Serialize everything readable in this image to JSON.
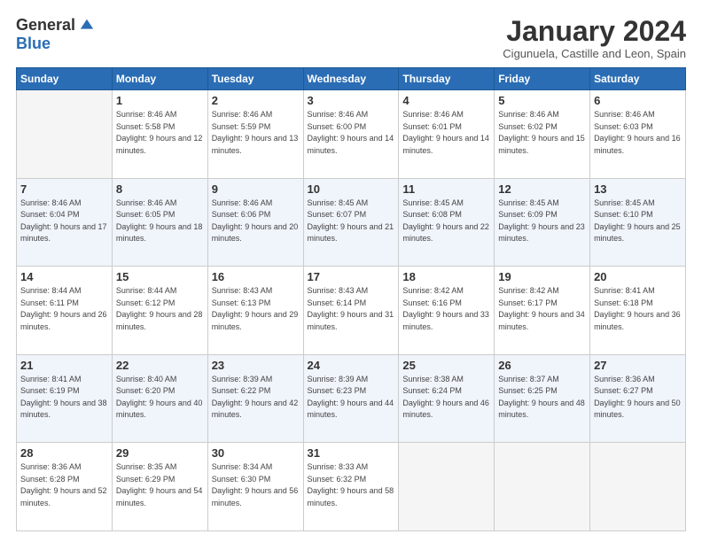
{
  "logo": {
    "general": "General",
    "blue": "Blue"
  },
  "header": {
    "month": "January 2024",
    "location": "Cigunuela, Castille and Leon, Spain"
  },
  "weekdays": [
    "Sunday",
    "Monday",
    "Tuesday",
    "Wednesday",
    "Thursday",
    "Friday",
    "Saturday"
  ],
  "weeks": [
    [
      {
        "day": "",
        "sunrise": "",
        "sunset": "",
        "daylight": ""
      },
      {
        "day": "1",
        "sunrise": "Sunrise: 8:46 AM",
        "sunset": "Sunset: 5:58 PM",
        "daylight": "Daylight: 9 hours and 12 minutes."
      },
      {
        "day": "2",
        "sunrise": "Sunrise: 8:46 AM",
        "sunset": "Sunset: 5:59 PM",
        "daylight": "Daylight: 9 hours and 13 minutes."
      },
      {
        "day": "3",
        "sunrise": "Sunrise: 8:46 AM",
        "sunset": "Sunset: 6:00 PM",
        "daylight": "Daylight: 9 hours and 14 minutes."
      },
      {
        "day": "4",
        "sunrise": "Sunrise: 8:46 AM",
        "sunset": "Sunset: 6:01 PM",
        "daylight": "Daylight: 9 hours and 14 minutes."
      },
      {
        "day": "5",
        "sunrise": "Sunrise: 8:46 AM",
        "sunset": "Sunset: 6:02 PM",
        "daylight": "Daylight: 9 hours and 15 minutes."
      },
      {
        "day": "6",
        "sunrise": "Sunrise: 8:46 AM",
        "sunset": "Sunset: 6:03 PM",
        "daylight": "Daylight: 9 hours and 16 minutes."
      }
    ],
    [
      {
        "day": "7",
        "sunrise": "Sunrise: 8:46 AM",
        "sunset": "Sunset: 6:04 PM",
        "daylight": "Daylight: 9 hours and 17 minutes."
      },
      {
        "day": "8",
        "sunrise": "Sunrise: 8:46 AM",
        "sunset": "Sunset: 6:05 PM",
        "daylight": "Daylight: 9 hours and 18 minutes."
      },
      {
        "day": "9",
        "sunrise": "Sunrise: 8:46 AM",
        "sunset": "Sunset: 6:06 PM",
        "daylight": "Daylight: 9 hours and 20 minutes."
      },
      {
        "day": "10",
        "sunrise": "Sunrise: 8:45 AM",
        "sunset": "Sunset: 6:07 PM",
        "daylight": "Daylight: 9 hours and 21 minutes."
      },
      {
        "day": "11",
        "sunrise": "Sunrise: 8:45 AM",
        "sunset": "Sunset: 6:08 PM",
        "daylight": "Daylight: 9 hours and 22 minutes."
      },
      {
        "day": "12",
        "sunrise": "Sunrise: 8:45 AM",
        "sunset": "Sunset: 6:09 PM",
        "daylight": "Daylight: 9 hours and 23 minutes."
      },
      {
        "day": "13",
        "sunrise": "Sunrise: 8:45 AM",
        "sunset": "Sunset: 6:10 PM",
        "daylight": "Daylight: 9 hours and 25 minutes."
      }
    ],
    [
      {
        "day": "14",
        "sunrise": "Sunrise: 8:44 AM",
        "sunset": "Sunset: 6:11 PM",
        "daylight": "Daylight: 9 hours and 26 minutes."
      },
      {
        "day": "15",
        "sunrise": "Sunrise: 8:44 AM",
        "sunset": "Sunset: 6:12 PM",
        "daylight": "Daylight: 9 hours and 28 minutes."
      },
      {
        "day": "16",
        "sunrise": "Sunrise: 8:43 AM",
        "sunset": "Sunset: 6:13 PM",
        "daylight": "Daylight: 9 hours and 29 minutes."
      },
      {
        "day": "17",
        "sunrise": "Sunrise: 8:43 AM",
        "sunset": "Sunset: 6:14 PM",
        "daylight": "Daylight: 9 hours and 31 minutes."
      },
      {
        "day": "18",
        "sunrise": "Sunrise: 8:42 AM",
        "sunset": "Sunset: 6:16 PM",
        "daylight": "Daylight: 9 hours and 33 minutes."
      },
      {
        "day": "19",
        "sunrise": "Sunrise: 8:42 AM",
        "sunset": "Sunset: 6:17 PM",
        "daylight": "Daylight: 9 hours and 34 minutes."
      },
      {
        "day": "20",
        "sunrise": "Sunrise: 8:41 AM",
        "sunset": "Sunset: 6:18 PM",
        "daylight": "Daylight: 9 hours and 36 minutes."
      }
    ],
    [
      {
        "day": "21",
        "sunrise": "Sunrise: 8:41 AM",
        "sunset": "Sunset: 6:19 PM",
        "daylight": "Daylight: 9 hours and 38 minutes."
      },
      {
        "day": "22",
        "sunrise": "Sunrise: 8:40 AM",
        "sunset": "Sunset: 6:20 PM",
        "daylight": "Daylight: 9 hours and 40 minutes."
      },
      {
        "day": "23",
        "sunrise": "Sunrise: 8:39 AM",
        "sunset": "Sunset: 6:22 PM",
        "daylight": "Daylight: 9 hours and 42 minutes."
      },
      {
        "day": "24",
        "sunrise": "Sunrise: 8:39 AM",
        "sunset": "Sunset: 6:23 PM",
        "daylight": "Daylight: 9 hours and 44 minutes."
      },
      {
        "day": "25",
        "sunrise": "Sunrise: 8:38 AM",
        "sunset": "Sunset: 6:24 PM",
        "daylight": "Daylight: 9 hours and 46 minutes."
      },
      {
        "day": "26",
        "sunrise": "Sunrise: 8:37 AM",
        "sunset": "Sunset: 6:25 PM",
        "daylight": "Daylight: 9 hours and 48 minutes."
      },
      {
        "day": "27",
        "sunrise": "Sunrise: 8:36 AM",
        "sunset": "Sunset: 6:27 PM",
        "daylight": "Daylight: 9 hours and 50 minutes."
      }
    ],
    [
      {
        "day": "28",
        "sunrise": "Sunrise: 8:36 AM",
        "sunset": "Sunset: 6:28 PM",
        "daylight": "Daylight: 9 hours and 52 minutes."
      },
      {
        "day": "29",
        "sunrise": "Sunrise: 8:35 AM",
        "sunset": "Sunset: 6:29 PM",
        "daylight": "Daylight: 9 hours and 54 minutes."
      },
      {
        "day": "30",
        "sunrise": "Sunrise: 8:34 AM",
        "sunset": "Sunset: 6:30 PM",
        "daylight": "Daylight: 9 hours and 56 minutes."
      },
      {
        "day": "31",
        "sunrise": "Sunrise: 8:33 AM",
        "sunset": "Sunset: 6:32 PM",
        "daylight": "Daylight: 9 hours and 58 minutes."
      },
      {
        "day": "",
        "sunrise": "",
        "sunset": "",
        "daylight": ""
      },
      {
        "day": "",
        "sunrise": "",
        "sunset": "",
        "daylight": ""
      },
      {
        "day": "",
        "sunrise": "",
        "sunset": "",
        "daylight": ""
      }
    ]
  ]
}
